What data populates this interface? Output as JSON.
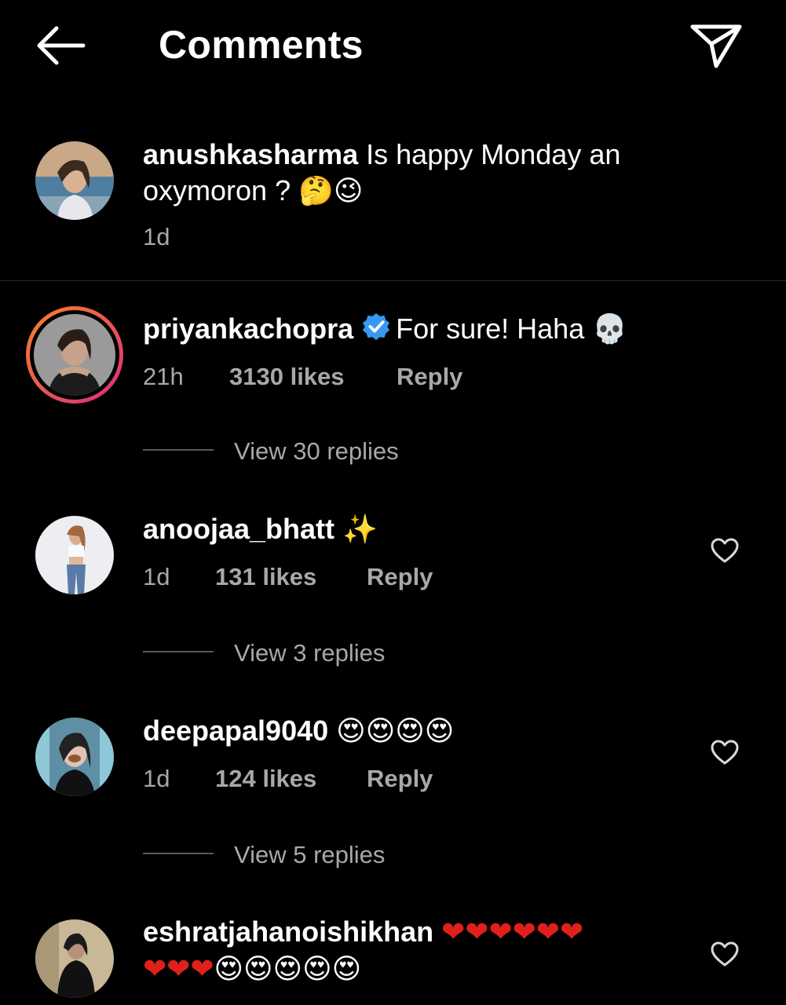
{
  "header": {
    "title": "Comments"
  },
  "caption": {
    "username": "anushkasharma",
    "text_line1": "Is happy Monday an",
    "text_line2": "oxymoron ?",
    "emoji": "🤔😉",
    "time": "1d"
  },
  "comments": [
    {
      "username": "priyankachopra",
      "text": "For sure! Haha",
      "emoji": "💀",
      "time": "21h",
      "likes": "3130 likes",
      "reply": "Reply",
      "view_replies": "View 30 replies"
    },
    {
      "username": "anoojaa_bhatt",
      "emoji": "✨",
      "time": "1d",
      "likes": "131 likes",
      "reply": "Reply",
      "view_replies": "View 3 replies"
    },
    {
      "username": "deepapal9040",
      "emoji": "😍😍😍😍",
      "time": "1d",
      "likes": "124 likes",
      "reply": "Reply",
      "view_replies": "View 5 replies"
    },
    {
      "username": "eshratjahanoishikhan",
      "emoji_line1": "❤❤❤❤❤❤",
      "emoji_line2_hearts": "❤❤❤",
      "emoji_line2_faces": "😍😍😍😍😍"
    }
  ],
  "icons": {
    "back": "arrow-left",
    "send": "paper-plane",
    "like": "heart-outline",
    "verified": "verified-badge"
  },
  "colors": {
    "background": "#000000",
    "text": "#ffffff",
    "secondary": "#a8a8a8",
    "verified": "#3897f0",
    "story_ring_start": "#f58529",
    "story_ring_end": "#dd2a7b"
  }
}
